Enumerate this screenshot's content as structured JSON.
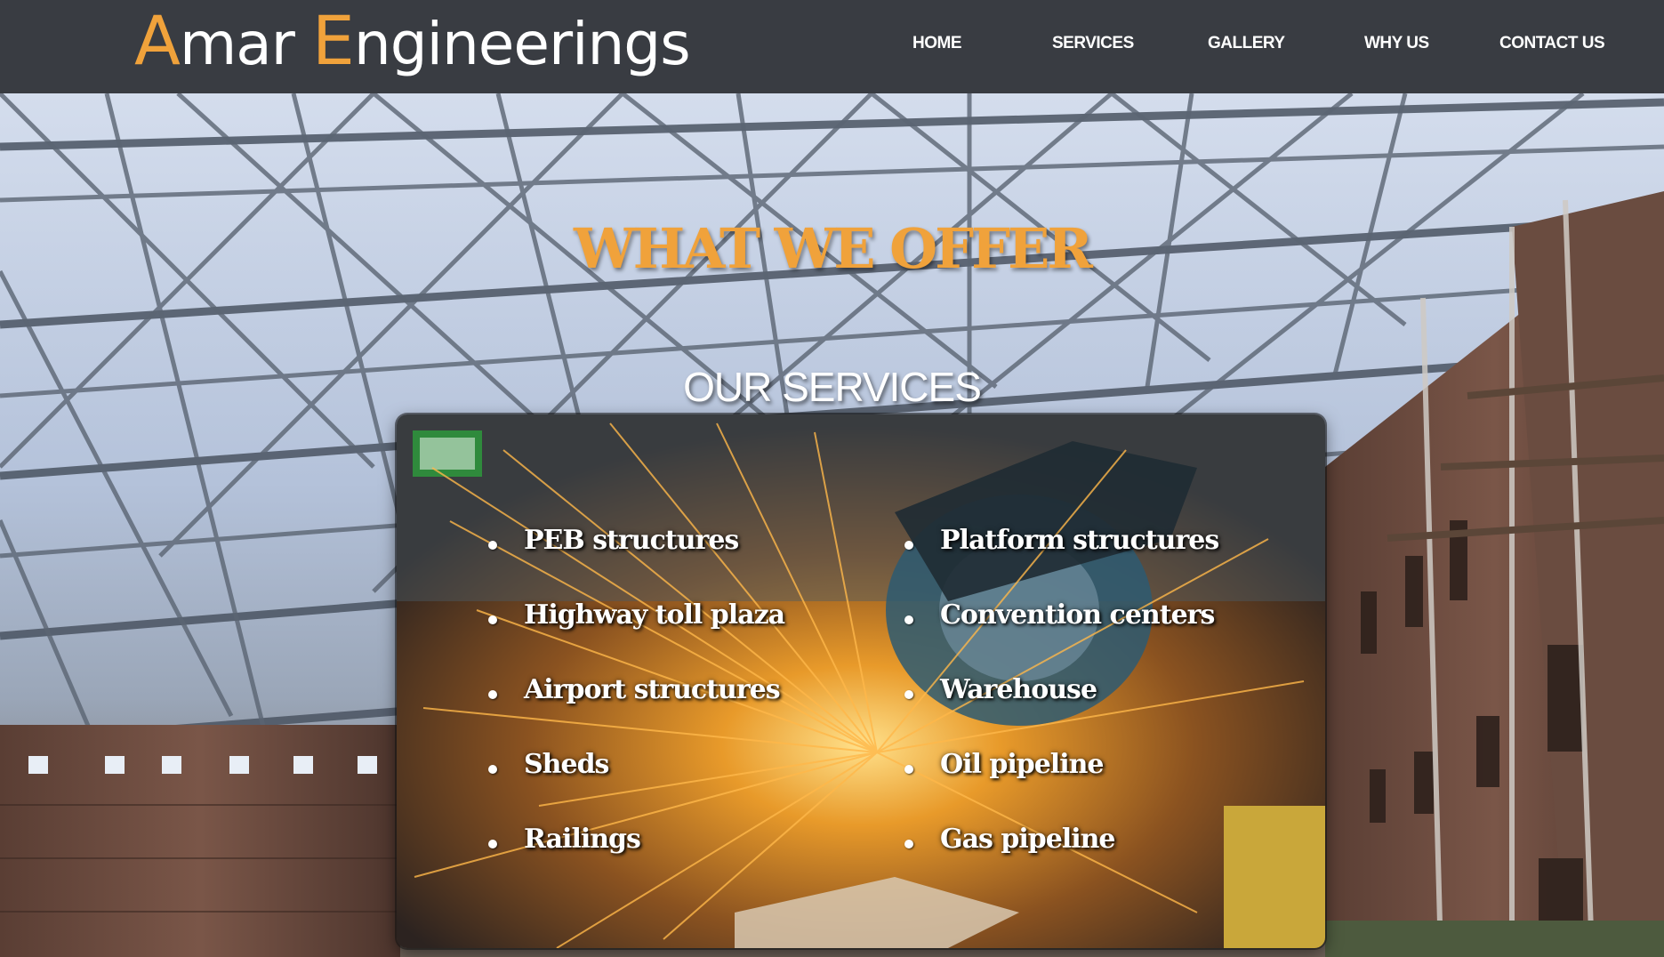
{
  "brand": {
    "initial_1": "A",
    "rest_1": "mar ",
    "initial_2": "E",
    "rest_2": "ngineerings",
    "accent_color": "#f0a23b",
    "text_color": "#ffffff"
  },
  "nav": {
    "items": [
      {
        "label": "HOME"
      },
      {
        "label": "SERVICES"
      },
      {
        "label": "GALLERY"
      },
      {
        "label": "WHY US"
      },
      {
        "label": "CONTACT US"
      }
    ],
    "background": "#393c42"
  },
  "hero": {
    "heading": "WHAT WE OFFER",
    "subheading": "OUR SERVICES",
    "heading_color": "#f0a23b"
  },
  "services": {
    "left": [
      {
        "label": "PEB structures"
      },
      {
        "label": "Highway toll plaza"
      },
      {
        "label": "Airport structures"
      },
      {
        "label": "Sheds"
      },
      {
        "label": "Railings"
      }
    ],
    "right": [
      {
        "label": "Platform structures"
      },
      {
        "label": "Convention centers"
      },
      {
        "label": "Warehouse"
      },
      {
        "label": "Oil pipeline"
      },
      {
        "label": "Gas pipeline"
      }
    ]
  }
}
